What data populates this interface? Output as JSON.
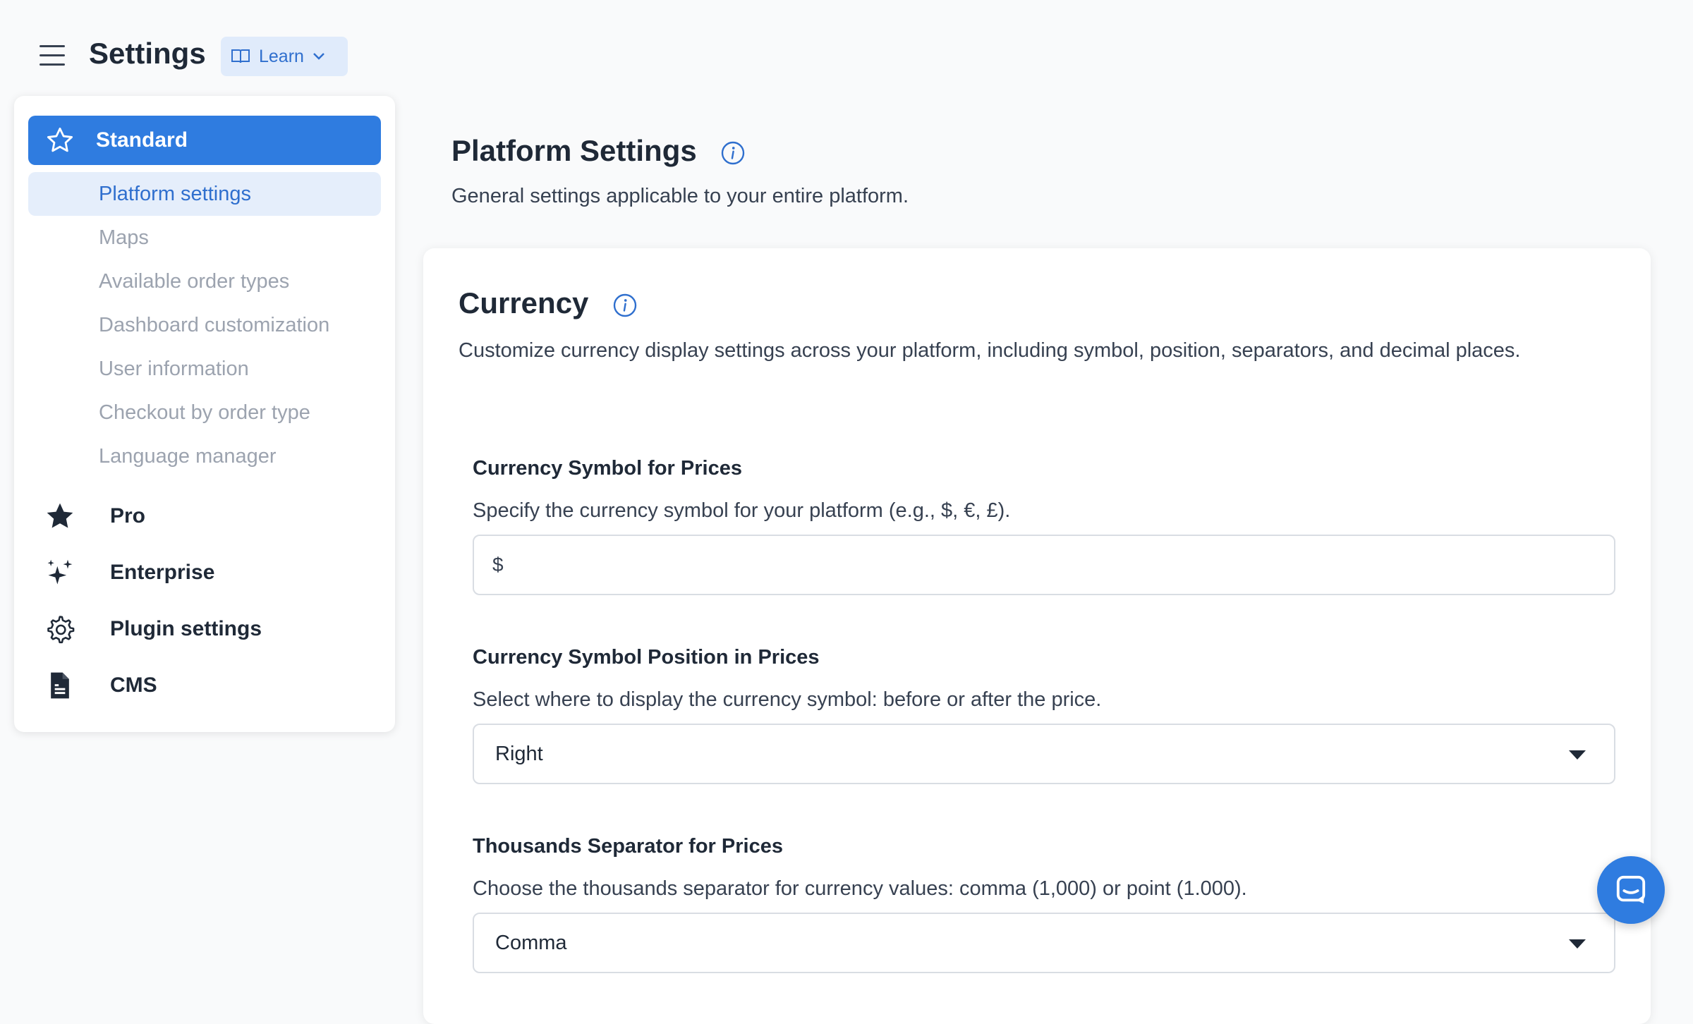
{
  "header": {
    "title": "Settings",
    "learn_label": "Learn"
  },
  "sidebar": {
    "standard_label": "Standard",
    "sub_items": [
      {
        "label": "Platform settings",
        "active": true
      },
      {
        "label": "Maps"
      },
      {
        "label": "Available order types"
      },
      {
        "label": "Dashboard customization"
      },
      {
        "label": "User information"
      },
      {
        "label": "Checkout by order type"
      },
      {
        "label": "Language manager"
      }
    ],
    "nav_items": [
      {
        "label": "Pro",
        "icon": "star-filled-icon"
      },
      {
        "label": "Enterprise",
        "icon": "sparkles-icon"
      },
      {
        "label": "Plugin settings",
        "icon": "gear-icon"
      },
      {
        "label": "CMS",
        "icon": "document-icon"
      }
    ]
  },
  "main": {
    "title": "Platform Settings",
    "subtitle": "General settings applicable to your entire platform."
  },
  "currency": {
    "title": "Currency",
    "description": "Customize currency display settings across your platform, including symbol, position, separators, and decimal places.",
    "symbol": {
      "label": "Currency Symbol for Prices",
      "help": "Specify the currency symbol for your platform (e.g., $, €, £).",
      "value": "$"
    },
    "position": {
      "label": "Currency Symbol Position in Prices",
      "help": "Select where to display the currency symbol: before or after the price.",
      "value": "Right"
    },
    "thousands": {
      "label": "Thousands Separator for Prices",
      "help": "Choose the thousands separator for currency values: comma (1,000) or point (1.000).",
      "value": "Comma"
    }
  },
  "colors": {
    "primary": "#2f7ce0",
    "active_bg": "#e5eefb",
    "muted_text": "#9ca3af"
  }
}
